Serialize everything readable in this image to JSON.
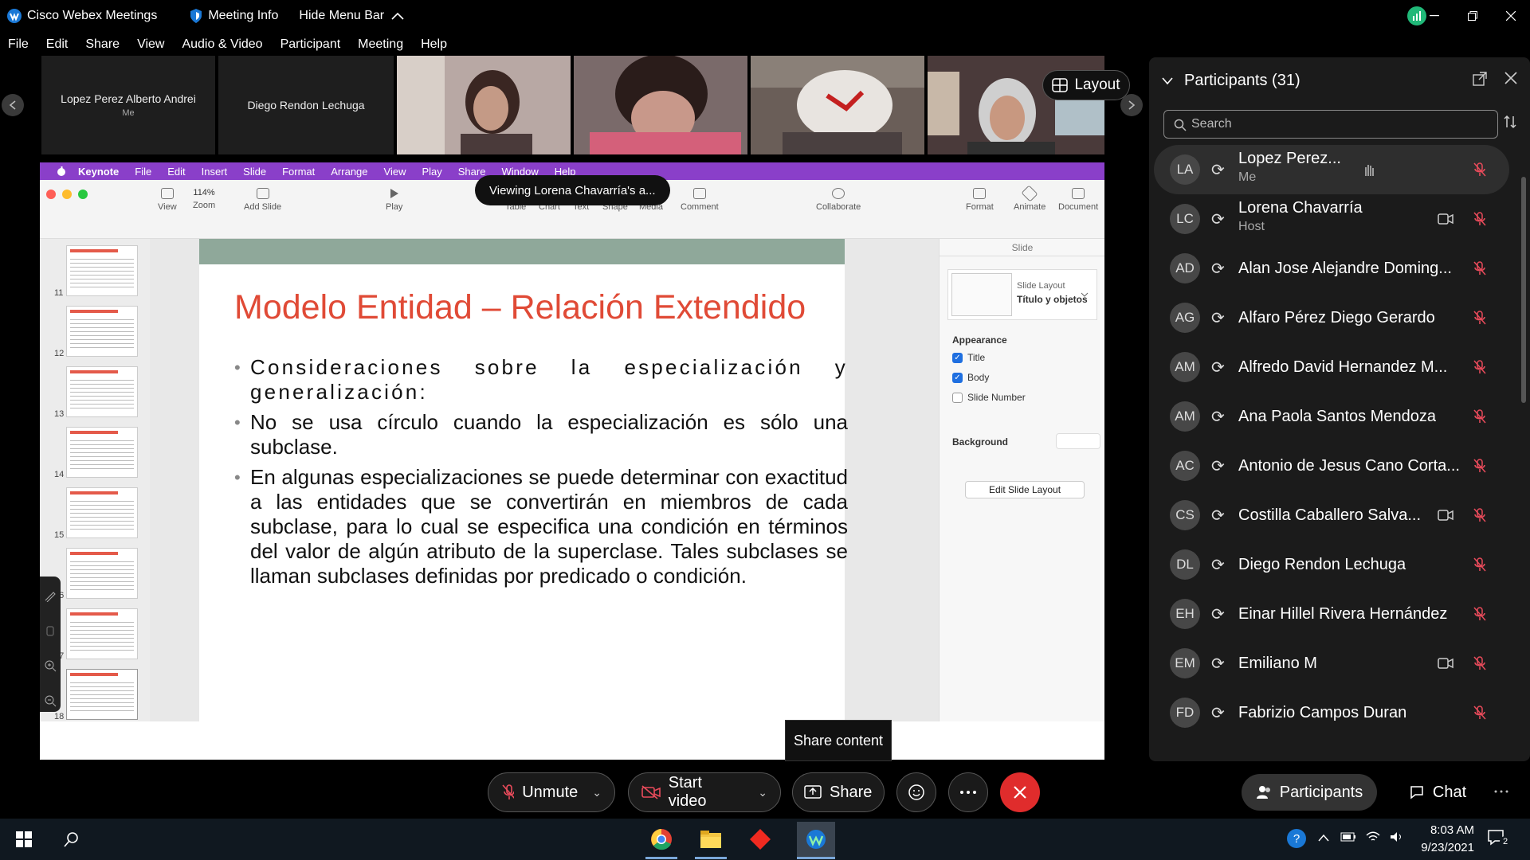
{
  "titlebar": {
    "app_name": "Cisco Webex Meetings",
    "meeting_info": "Meeting Info",
    "hide_menu_bar": "Hide Menu Bar"
  },
  "menu": [
    "File",
    "Edit",
    "Share",
    "View",
    "Audio & Video",
    "Participant",
    "Meeting",
    "Help"
  ],
  "strip": {
    "tiles": [
      {
        "name": "Lopez Perez Alberto Andrei",
        "sub": "Me"
      },
      {
        "name": "Diego Rendon Lechuga",
        "sub": ""
      }
    ],
    "layout_label": "Layout"
  },
  "share": {
    "keynote_menu": [
      "Keynote",
      "File",
      "Edit",
      "Insert",
      "Slide",
      "Format",
      "Arrange",
      "View",
      "Play",
      "Share",
      "Window",
      "Help"
    ],
    "viewing_tooltip": "Viewing Lorena Chavarría's a...",
    "toolbar": {
      "zoom": "114%",
      "items": [
        "View",
        "Zoom",
        "Add Slide",
        "Play",
        "Table",
        "Chart",
        "Text",
        "Shape",
        "Media",
        "Comment",
        "Collaborate",
        "Format",
        "Animate",
        "Document"
      ]
    },
    "thumb_numbers": [
      "11",
      "12",
      "13",
      "14",
      "15",
      "16",
      "17",
      "18"
    ],
    "slide": {
      "title": "Modelo Entidad – Relación Extendido",
      "bullets": [
        "Consideraciones sobre la especialización y generalización:",
        "No se usa círculo cuando la especialización es sólo una subclase.",
        "En algunas especializaciones se puede determinar con exactitud a las entidades que se convertirán en miembros de cada subclase, para lo cual se especifica una condición en términos del valor de algún atributo de la superclase. Tales subclases se llaman subclases definidas por predicado o condición."
      ]
    },
    "inspector": {
      "tab": "Slide",
      "layout_label": "Slide Layout",
      "layout_value": "Título y objetos",
      "appearance": "Appearance",
      "title_chk": "Title",
      "body_chk": "Body",
      "slide_number_chk": "Slide Number",
      "background": "Background",
      "edit_layout": "Edit Slide Layout"
    }
  },
  "share_content_tip": "Share content",
  "participants": {
    "header": "Participants (31)",
    "search_placeholder": "Search",
    "list": [
      {
        "initials": "LA",
        "name": "Lopez Perez...",
        "sub": "Me",
        "video": false
      },
      {
        "initials": "LC",
        "name": "Lorena Chavarría",
        "sub": "Host",
        "video": true
      },
      {
        "initials": "AD",
        "name": "Alan Jose Alejandre Doming...",
        "sub": "",
        "video": false
      },
      {
        "initials": "AG",
        "name": "Alfaro Pérez Diego Gerardo",
        "sub": "",
        "video": false
      },
      {
        "initials": "AM",
        "name": "Alfredo David Hernandez M...",
        "sub": "",
        "video": false
      },
      {
        "initials": "AM",
        "name": "Ana Paola Santos Mendoza",
        "sub": "",
        "video": false
      },
      {
        "initials": "AC",
        "name": "Antonio de Jesus Cano Corta...",
        "sub": "",
        "video": false
      },
      {
        "initials": "CS",
        "name": "Costilla Caballero Salva...",
        "sub": "",
        "video": true
      },
      {
        "initials": "DL",
        "name": "Diego Rendon Lechuga",
        "sub": "",
        "video": false
      },
      {
        "initials": "EH",
        "name": "Einar Hillel Rivera Hernández",
        "sub": "",
        "video": false
      },
      {
        "initials": "EM",
        "name": "Emiliano M",
        "sub": "",
        "video": true
      },
      {
        "initials": "FD",
        "name": "Fabrizio Campos Duran",
        "sub": "",
        "video": false
      }
    ]
  },
  "controls": {
    "unmute": "Unmute",
    "start_video": "Start video",
    "share": "Share",
    "participants": "Participants",
    "chat": "Chat"
  },
  "taskbar": {
    "time": "8:03 AM",
    "date": "9/23/2021",
    "notif_count": "2"
  },
  "colors": {
    "keynote_purple": "#8a3fc9",
    "slide_title": "#e04a36",
    "end_red": "#e02c2c",
    "webex_green": "#20b878"
  }
}
